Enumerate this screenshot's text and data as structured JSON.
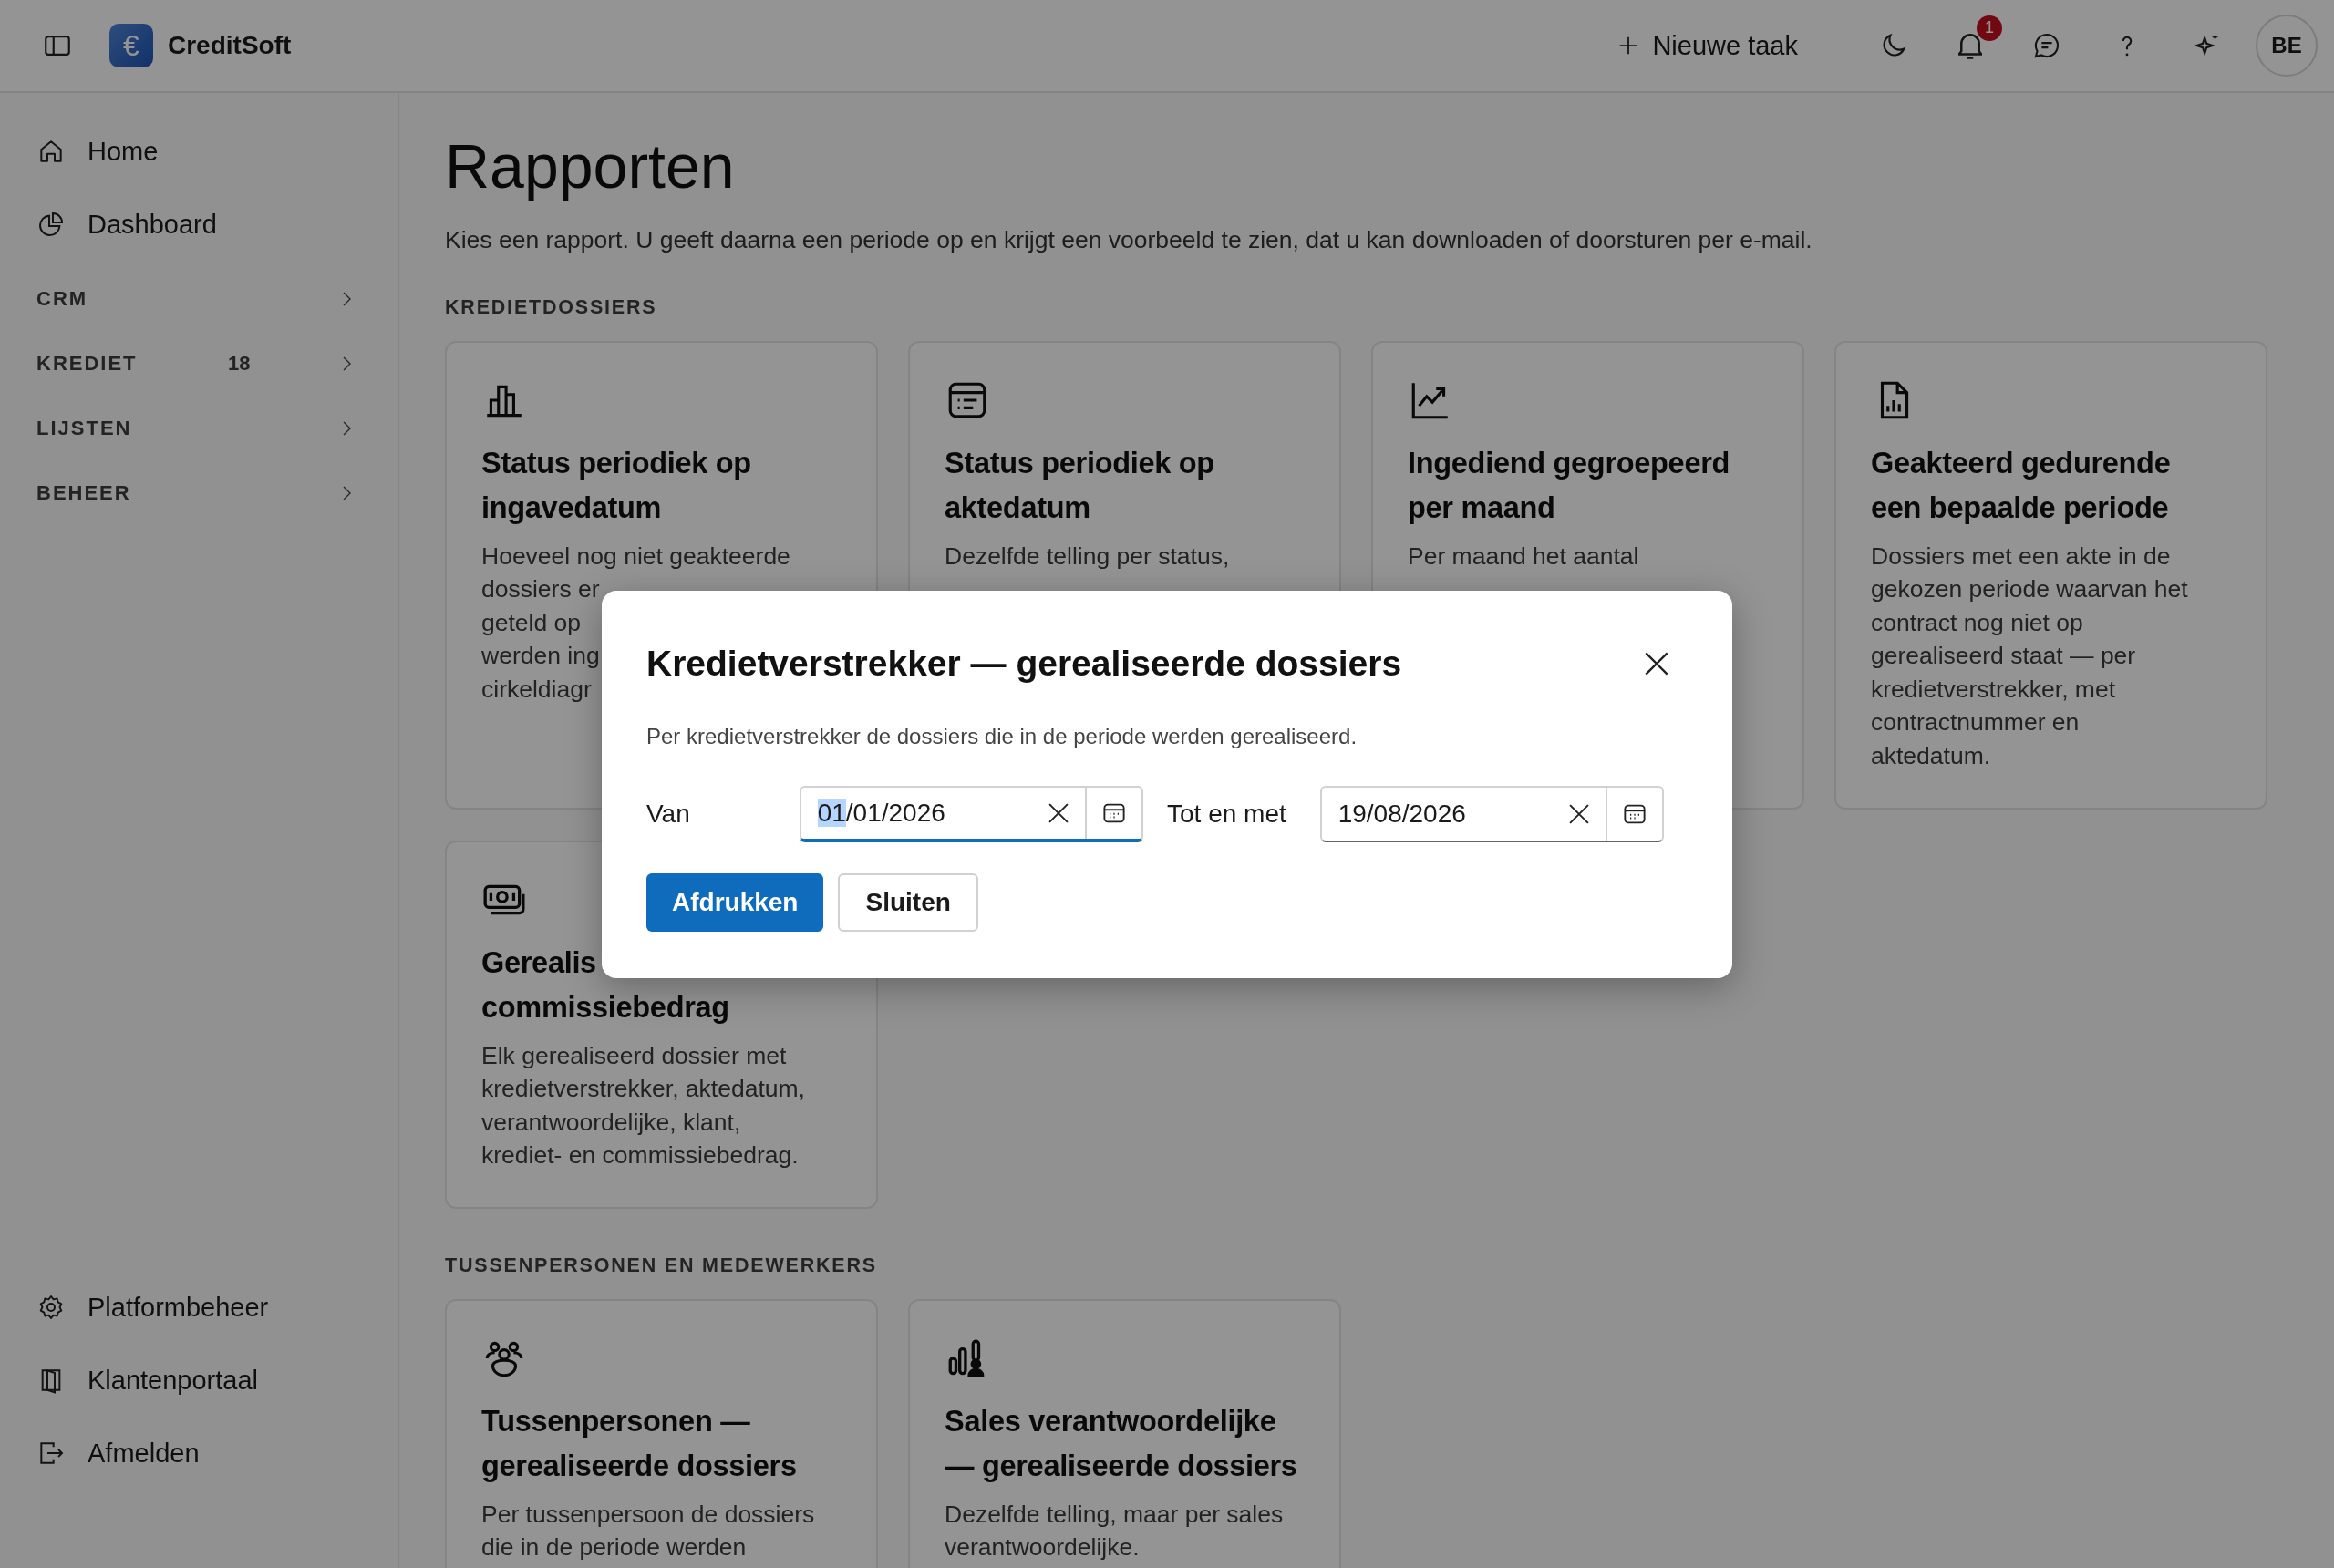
{
  "topbar": {
    "brand": "CreditSoft",
    "brand_symbol": "€",
    "new_task": "Nieuwe taak",
    "notification_count": "1",
    "avatar": "BE"
  },
  "sidebar": {
    "items": [
      {
        "label": "Home"
      },
      {
        "label": "Dashboard"
      }
    ],
    "groups": [
      {
        "label": "CRM"
      },
      {
        "label": "KREDIET",
        "count": "18"
      },
      {
        "label": "LIJSTEN"
      },
      {
        "label": "BEHEER"
      }
    ],
    "footer_items": [
      {
        "label": "Platformbeheer"
      },
      {
        "label": "Klantenportaal"
      },
      {
        "label": "Afmelden"
      }
    ]
  },
  "page": {
    "title": "Rapporten",
    "subtitle": "Kies een rapport. U geeft daarna een periode op en krijgt een voorbeeld te zien, dat u kan downloaden of doorsturen per e-mail.",
    "sections": [
      {
        "label": "KREDIETDOSSIERS",
        "cards": [
          {
            "title_lines": [
              "Status periodiek op",
              "ingavedatum"
            ],
            "description_lines": [
              "Hoeveel nog niet geakteerde",
              "dossiers er",
              "geteld op",
              "werden ing",
              "cirkeldiagr"
            ]
          },
          {
            "title_lines": [
              "Status periodiek op",
              "aktedatum"
            ],
            "description_lines": [
              "Dezelfde telling per status,"
            ]
          },
          {
            "title_lines": [
              "Ingediend gegroepeerd",
              "per maand"
            ],
            "description_lines": [
              "Per maand het aantal"
            ]
          },
          {
            "title_lines": [
              "Geakteerd gedurende",
              "een bepaalde periode"
            ],
            "description_lines": [
              "Dossiers met een akte in de",
              "gekozen periode waarvan het",
              "contract nog niet op",
              "gerealiseerd staat — per",
              "kredietverstrekker, met",
              "contractnummer en",
              "aktedatum."
            ]
          },
          {
            "title_lines": [
              "Gerealis",
              "commissiebedrag"
            ],
            "description_lines": [
              "Elk gerealiseerd dossier met",
              "kredietverstrekker, aktedatum,",
              "verantwoordelijke, klant,",
              "krediet- en commissiebedrag."
            ]
          }
        ]
      },
      {
        "label": "TUSSENPERSONEN EN MEDEWERKERS",
        "cards": [
          {
            "title_lines": [
              "Tussenpersonen —",
              "gerealiseerde dossiers"
            ],
            "description_lines": [
              "Per tussenpersoon de dossiers",
              "die in de periode werden"
            ]
          },
          {
            "title_lines": [
              "Sales verantwoordelijke",
              "— gerealiseerde dossiers"
            ],
            "description_lines": [
              "Dezelfde telling, maar per sales",
              "verantwoordelijke."
            ]
          }
        ]
      }
    ]
  },
  "dialog": {
    "title": "Kredietverstrekker — gerealiseerde dossiers",
    "description": "Per kredietverstrekker de dossiers die in de periode werden gerealiseerd.",
    "fields": [
      {
        "label": "Van",
        "value": "01/01/2026",
        "focused": true
      },
      {
        "label": "Tot en met",
        "value": "19/08/2026",
        "focused": false
      }
    ],
    "buttons": [
      {
        "label": "Afdrukken",
        "kind": "primary"
      },
      {
        "label": "Sluiten",
        "kind": "secondary"
      }
    ]
  }
}
